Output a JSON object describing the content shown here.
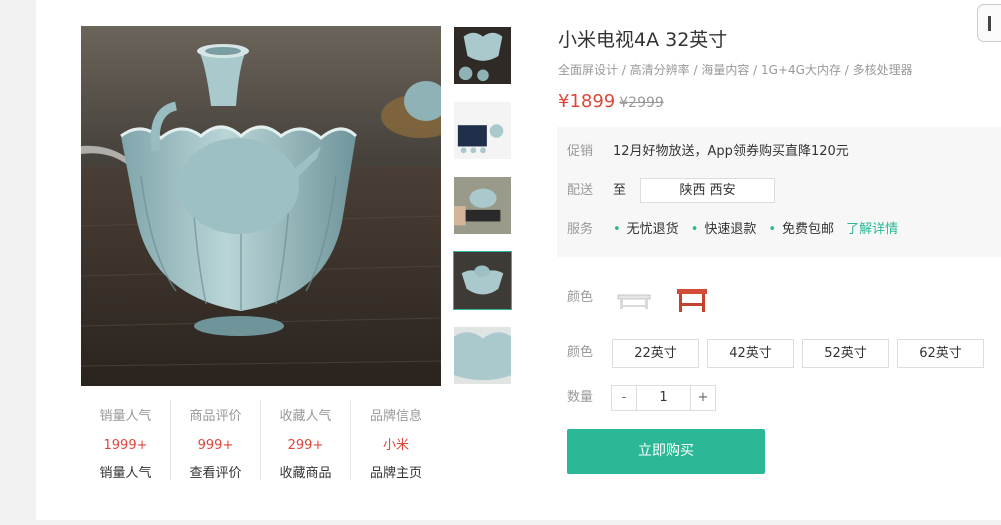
{
  "product": {
    "title": "小米电视4A 32英寸",
    "subtitle": "全面屏设计 / 高清分辨率 / 海量内容 / 1G+4G大内存 / 多核处理器",
    "price_now": "¥1899",
    "price_old": "¥2999"
  },
  "promo": {
    "promo_label": "促销",
    "promo_text": "12月好物放送，App领券购买直降120元",
    "ship_label": "配送",
    "ship_to": "至",
    "ship_location": "陕西 西安",
    "service_label": "服务",
    "services": [
      "无忧退货",
      "快速退款",
      "免费包邮"
    ],
    "service_more": "了解详情"
  },
  "options": {
    "color_label": "颜色",
    "color_icons": [
      "white-bench-icon",
      "red-table-icon"
    ],
    "size_label": "颜色",
    "sizes": [
      "22英寸",
      "42英寸",
      "52英寸",
      "62英寸"
    ],
    "qty_label": "数量",
    "qty_minus": "-",
    "qty_value": "1",
    "qty_plus": "+",
    "buy_label": "立即购买"
  },
  "stats": [
    {
      "title": "销量人气",
      "value": "1999+",
      "link": "销量人气"
    },
    {
      "title": "商品评价",
      "value": "999+",
      "link": "查看评价"
    },
    {
      "title": "收藏人气",
      "value": "299+",
      "link": "收藏商品"
    },
    {
      "title": "品牌信息",
      "value": "小米",
      "link": "品牌主页"
    }
  ],
  "colors": {
    "accent": "#2bb897",
    "price": "#e0453a"
  }
}
